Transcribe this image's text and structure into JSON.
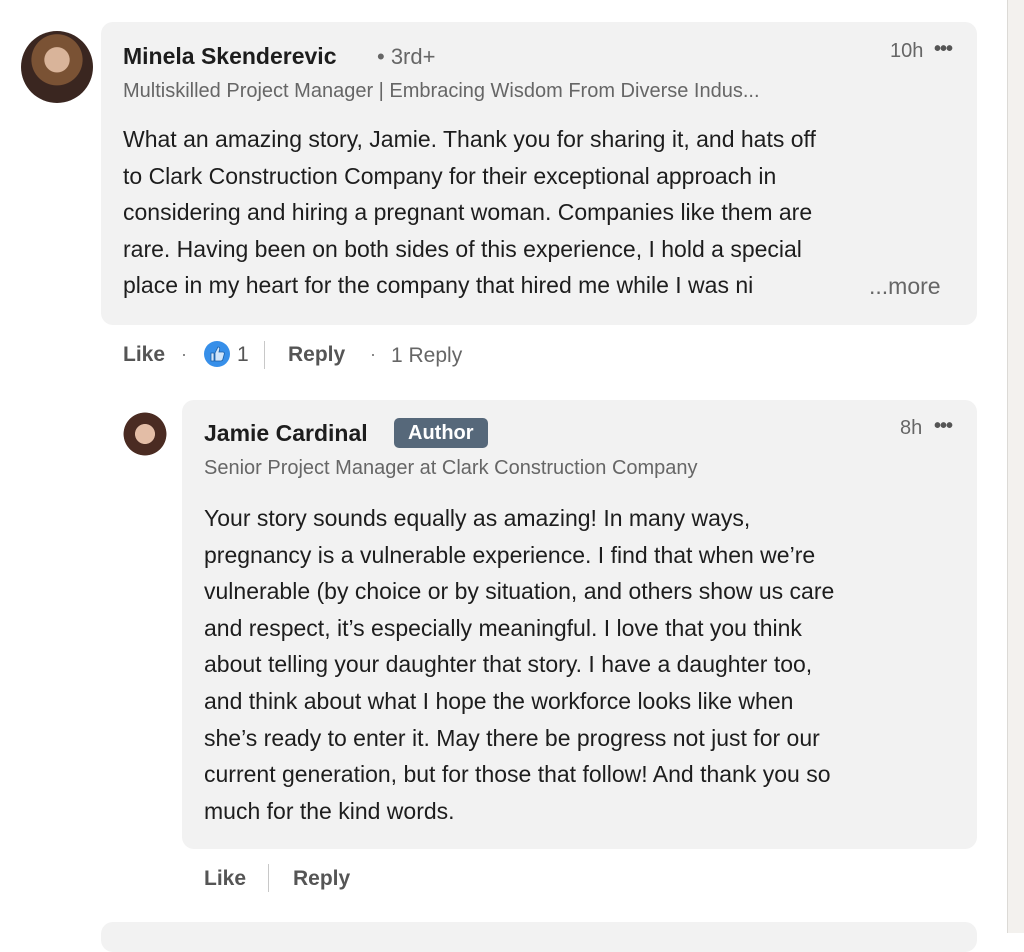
{
  "comments": [
    {
      "author": "Minela Skenderevic",
      "degree": "• 3rd+",
      "headline": "Multiskilled Project Manager | Embracing Wisdom From Diverse Indus...",
      "time": "10h",
      "menu_icon": "more-horizontal-icon",
      "lines": [
        "What an amazing story, Jamie. Thank you for sharing it, and hats off",
        "to Clark Construction Company for their exceptional approach in",
        "considering and hiring a pregnant woman. Companies like them are",
        "rare. Having been on both sides of this experience, I hold a special",
        "place in my heart for the company that hired me while I was ni"
      ],
      "see_more": "...more",
      "actions": {
        "like": "Like",
        "dot": "·",
        "reaction_icon": "thumbs-up-icon",
        "reaction_count": "1",
        "reply": "Reply",
        "reply_count": "1 Reply"
      }
    },
    {
      "author": "Jamie Cardinal",
      "badge": "Author",
      "headline": "Senior Project Manager at Clark Construction Company",
      "time": "8h",
      "menu_icon": "more-horizontal-icon",
      "lines": [
        "Your story sounds equally as amazing! In many ways,",
        "pregnancy is a vulnerable experience. I find that when we’re",
        "vulnerable (by choice or by situation, and others show us care",
        "and respect, it’s especially meaningful. I love that you think",
        "about telling your daughter that story. I have a daughter too,",
        "and think about what I hope the workforce looks like when",
        "she’s ready to enter it. May there be progress not just for our",
        "current generation, but for those that follow! And thank you so",
        "much for the kind words."
      ],
      "actions": {
        "like": "Like",
        "reply": "Reply"
      }
    }
  ],
  "colors": {
    "bubble": "#f2f2f2",
    "badge": "#56687a",
    "like": "#378fe9"
  },
  "dots_glyph": "•••"
}
